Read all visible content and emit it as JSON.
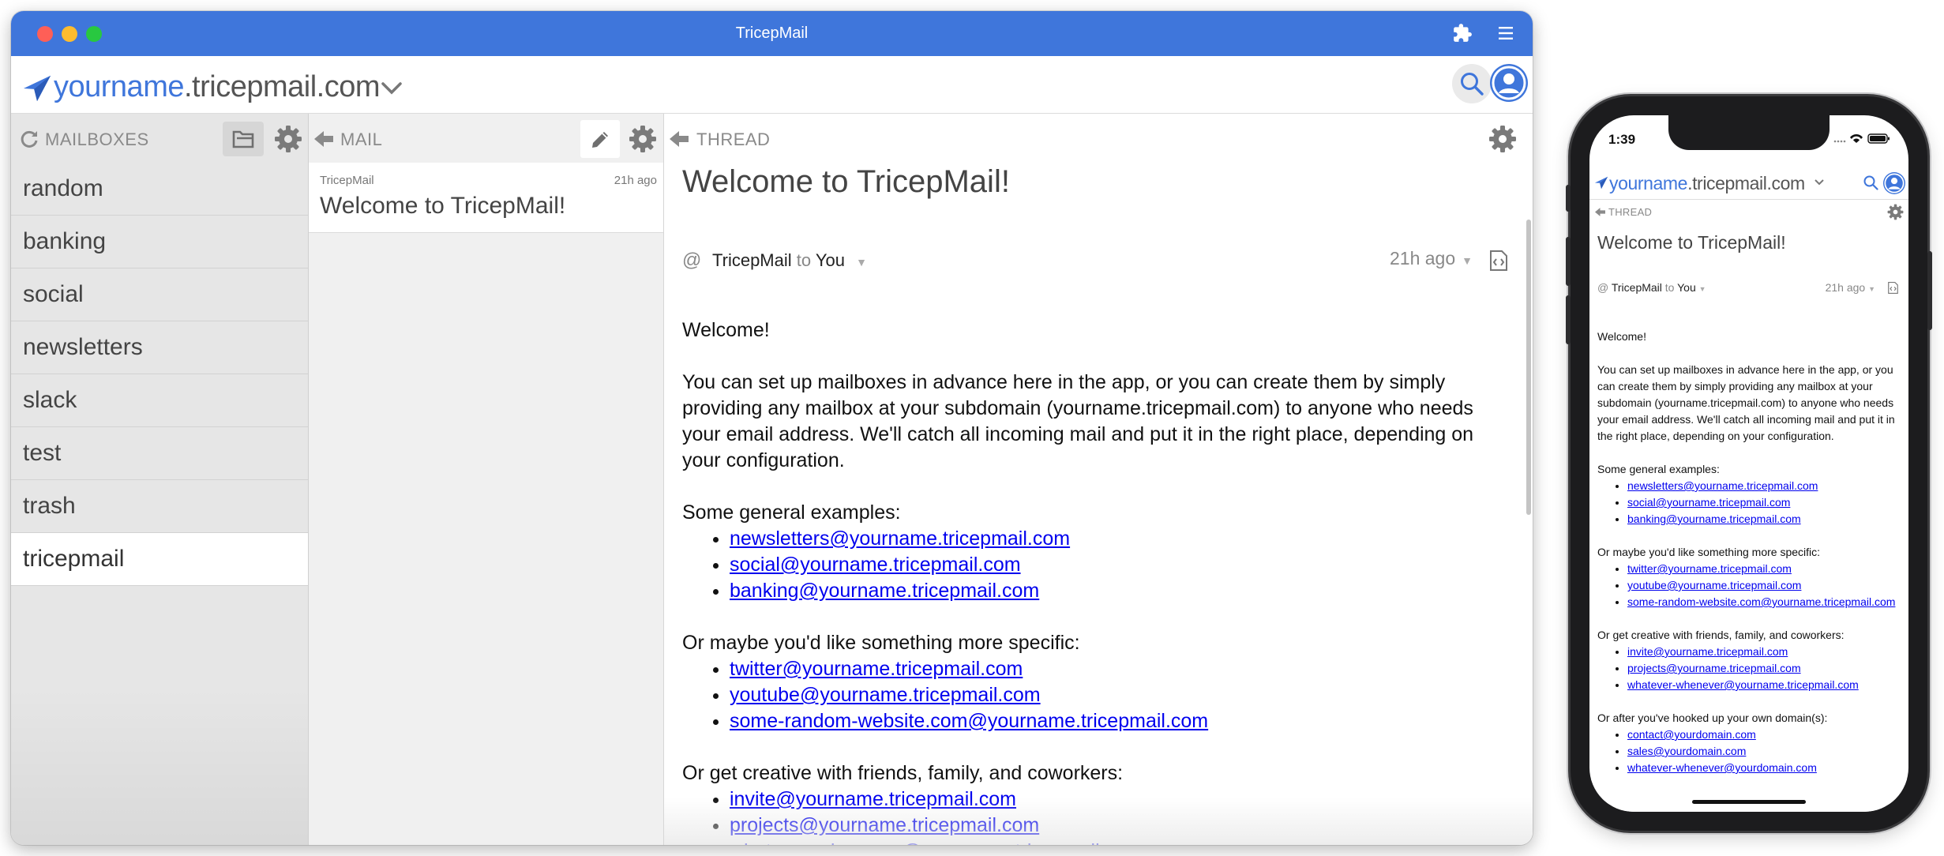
{
  "app": {
    "window_title": "TricepMail",
    "domain_user": "yourname",
    "domain_host": ".tricepmail.com"
  },
  "mailboxes": {
    "header_label": "MAILBOXES",
    "items": [
      {
        "label": "random"
      },
      {
        "label": "banking"
      },
      {
        "label": "social"
      },
      {
        "label": "newsletters"
      },
      {
        "label": "slack"
      },
      {
        "label": "test"
      },
      {
        "label": "trash"
      },
      {
        "label": "tricepmail",
        "active": true
      }
    ]
  },
  "mail": {
    "header_label": "MAIL",
    "items": [
      {
        "from": "TricepMail",
        "time": "21h ago",
        "subject": "Welcome to TricepMail!"
      }
    ]
  },
  "thread": {
    "header_label": "THREAD",
    "subject": "Welcome to TricepMail!",
    "at_symbol": "@",
    "from": "TricepMail",
    "to_word": "to",
    "to": "You",
    "time": "21h ago",
    "body": {
      "greeting": "Welcome!",
      "intro": "You can set up mailboxes in advance here in the app, or you can create them by simply providing any mailbox at your subdomain (yourname.tricepmail.com) to anyone who needs your email address. We'll catch all incoming mail and put it in the right place, depending on your configuration.",
      "group1_title": "Some general examples:",
      "group1": [
        "newsletters@yourname.tricepmail.com",
        "social@yourname.tricepmail.com",
        "banking@yourname.tricepmail.com"
      ],
      "group2_title": "Or maybe you'd like something more specific:",
      "group2": [
        "twitter@yourname.tricepmail.com",
        "youtube@yourname.tricepmail.com",
        "some-random-website.com@yourname.tricepmail.com"
      ],
      "group3_title": "Or get creative with friends, family, and coworkers:",
      "group3": [
        "invite@yourname.tricepmail.com",
        "projects@yourname.tricepmail.com",
        "whatever-whenever@yourname.tricepmail.com"
      ],
      "group4_title": "Or after you've hooked up your own domain(s):",
      "group4": [
        "contact@yourdomain.com",
        "sales@yourdomain.com",
        "whatever-whenever@yourdomain.com"
      ]
    }
  },
  "phone": {
    "status_time": "1:39"
  },
  "colors": {
    "accent": "#3f76db",
    "link": "#0000ee",
    "sidebar_bg": "#e6e6e6"
  }
}
